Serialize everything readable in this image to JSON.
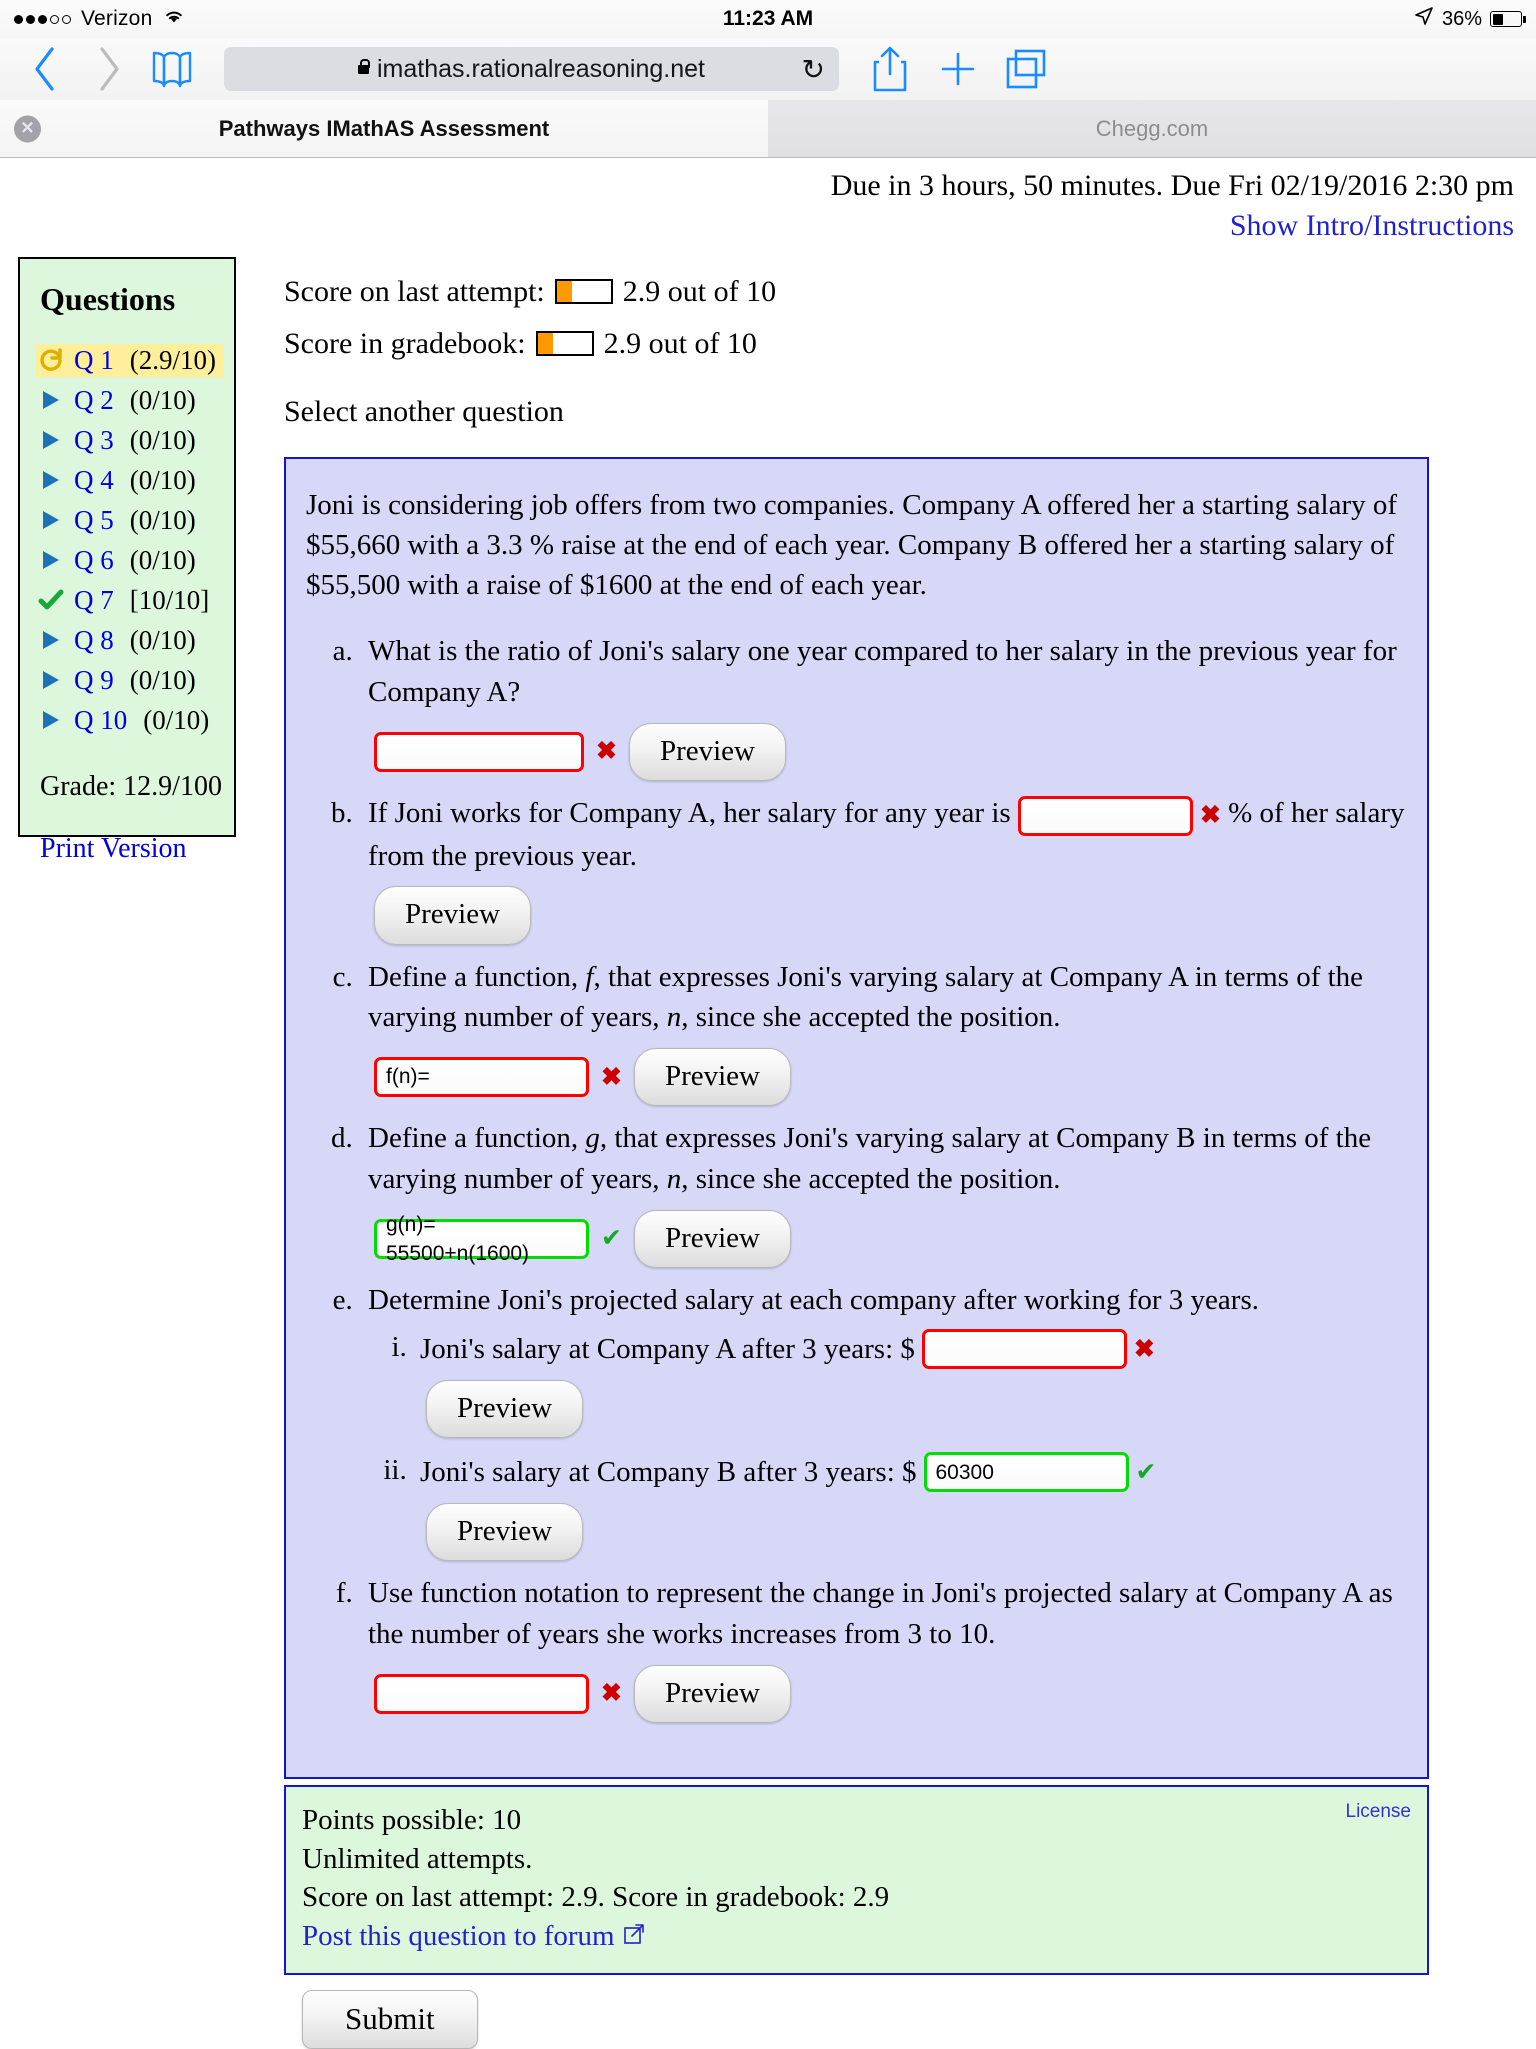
{
  "status_bar": {
    "carrier": "Verizon",
    "signal_filled": 3,
    "signal_total": 5,
    "wifi_icon": "wifi-icon",
    "time": "11:23 AM",
    "location_icon": "location-arrow-icon",
    "battery_percent": "36%",
    "battery_level": 36
  },
  "browser": {
    "back_icon": "chevron-left-icon",
    "forward_icon": "chevron-right-icon",
    "bookmarks_icon": "book-icon",
    "url": "imathas.rationalreasoning.net",
    "lock_icon": "lock-icon",
    "reload_icon": "reload-icon",
    "share_icon": "share-icon",
    "newtab_icon": "plus-icon",
    "tabs_icon": "tabs-icon"
  },
  "tabs": [
    {
      "title": "Pathways IMathAS Assessment",
      "active": true,
      "close_icon": "close-icon"
    },
    {
      "title": "Chegg.com",
      "active": false
    }
  ],
  "header": {
    "due_text": "Due in 3 hours, 50 minutes. Due Fri 02/19/2016 2:30 pm",
    "show_intro": "Show Intro/Instructions"
  },
  "sidebar": {
    "title": "Questions",
    "questions": [
      {
        "label": "Q 1",
        "score": "(2.9/10)",
        "icon": "redo-icon",
        "current": true
      },
      {
        "label": "Q 2",
        "score": "(0/10)",
        "icon": "play-icon",
        "current": false
      },
      {
        "label": "Q 3",
        "score": "(0/10)",
        "icon": "play-icon",
        "current": false
      },
      {
        "label": "Q 4",
        "score": "(0/10)",
        "icon": "play-icon",
        "current": false
      },
      {
        "label": "Q 5",
        "score": "(0/10)",
        "icon": "play-icon",
        "current": false
      },
      {
        "label": "Q 6",
        "score": "(0/10)",
        "icon": "play-icon",
        "current": false
      },
      {
        "label": "Q 7",
        "score": "[10/10]",
        "icon": "check-icon",
        "current": false
      },
      {
        "label": "Q 8",
        "score": "(0/10)",
        "icon": "play-icon",
        "current": false
      },
      {
        "label": "Q 9",
        "score": "(0/10)",
        "icon": "play-icon",
        "current": false
      },
      {
        "label": "Q 10",
        "score": "(0/10)",
        "icon": "play-icon",
        "current": false
      }
    ],
    "grade": "Grade: 12.9/100",
    "print_version": "Print Version"
  },
  "scores": {
    "last_attempt_label": "Score on last attempt:",
    "last_attempt_value": "2.9 out of 10",
    "last_attempt_percent": 29,
    "gradebook_label": "Score in gradebook:",
    "gradebook_value": "2.9 out of 10",
    "gradebook_percent": 29,
    "select_another": "Select another question"
  },
  "question": {
    "stem": "Joni is considering job offers from two companies. Company A offered her a starting salary of $55,660 with a 3.3 % raise at the end of each year. Company B offered her a starting salary of $55,500 with a raise of $1600 at the end of each year.",
    "parts": {
      "a": {
        "text": "What is the ratio of Joni's salary one year compared to her salary in the previous year for Company A?",
        "answer": "",
        "status": "incorrect",
        "preview_label": "Preview"
      },
      "b": {
        "text_before": "If Joni works for Company A, her salary for any year is",
        "text_after": "% of her salary from the previous year.",
        "answer": "",
        "status": "incorrect",
        "preview_label": "Preview"
      },
      "c": {
        "text_1": "Define a function, ",
        "var_1": "f",
        "text_2": ", that expresses Joni's varying salary at Company A in terms of the varying number of years, ",
        "var_2": "n",
        "text_3": ", since she accepted the position.",
        "answer": "f(n)=",
        "status": "incorrect",
        "preview_label": "Preview"
      },
      "d": {
        "text_1": "Define a function, ",
        "var_1": "g",
        "text_2": ", that expresses Joni's varying salary at Company B in terms of the varying number of years, ",
        "var_2": "n",
        "text_3": ", since she accepted the position.",
        "answer": "g(n)= 55500+n(1600)",
        "status": "correct",
        "preview_label": "Preview"
      },
      "e": {
        "text": "Determine Joni's projected salary at each company after working for 3 years.",
        "sub": [
          {
            "text": "Joni's salary at Company A after 3 years: $",
            "answer": "",
            "status": "incorrect",
            "preview_label": "Preview"
          },
          {
            "text": "Joni's salary at Company B after 3 years: $",
            "answer": "60300",
            "status": "correct",
            "preview_label": "Preview"
          }
        ]
      },
      "f": {
        "text": "Use function notation to represent the change in Joni's projected salary at Company A as the number of years she works increases from 3 to 10.",
        "answer": "",
        "status": "incorrect",
        "preview_label": "Preview"
      }
    }
  },
  "info": {
    "license": "License",
    "points_possible": "Points possible: 10",
    "attempts": "Unlimited attempts.",
    "scores_line": "Score on last attempt: 2.9. Score in gradebook: 2.9",
    "forum_link": "Post this question to forum",
    "external_icon": "external-link-icon"
  },
  "footer": {
    "submit_label": "Submit"
  },
  "colors": {
    "accent_blue": "#0000dd",
    "question_box_bg": "#d7d7f8",
    "question_box_border": "#1515cc",
    "sidebar_bg": "#ddf7dd",
    "highlight_yellow": "#ffef9a",
    "meter_orange": "#ff9900",
    "error_red": "#ff0000",
    "success_green": "#00dd00"
  }
}
